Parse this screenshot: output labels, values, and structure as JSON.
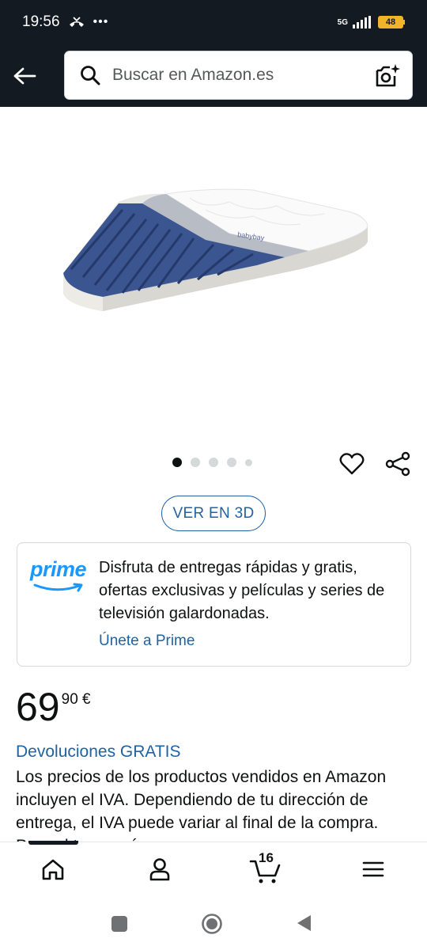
{
  "status_bar": {
    "time": "19:56",
    "network": "5G",
    "battery": "48"
  },
  "search": {
    "placeholder": "Buscar en Amazon.es"
  },
  "carousel": {
    "total_images": 5,
    "active_index": 0
  },
  "view_3d_label": "VER EN 3D",
  "prime_banner": {
    "logo_text": "prime",
    "description": "Disfruta de entregas rápidas y gratis, ofertas exclusivas y películas y series de televisión galardonadas.",
    "join_label": "Únete a Prime"
  },
  "price": {
    "whole": "69",
    "fraction": "90 €"
  },
  "returns_label": "Devoluciones GRATIS",
  "tax_note": "Los precios de los productos vendidos en Amazon incluyen el IVA. Dependiendo de tu dirección de entrega, el IVA puede variar al final de la compra. Para el tener más",
  "bottom_nav": {
    "cart_count": "16"
  },
  "colors": {
    "header_bg": "#131a22",
    "link": "#2162a1",
    "prime_blue": "#1a98ff"
  }
}
